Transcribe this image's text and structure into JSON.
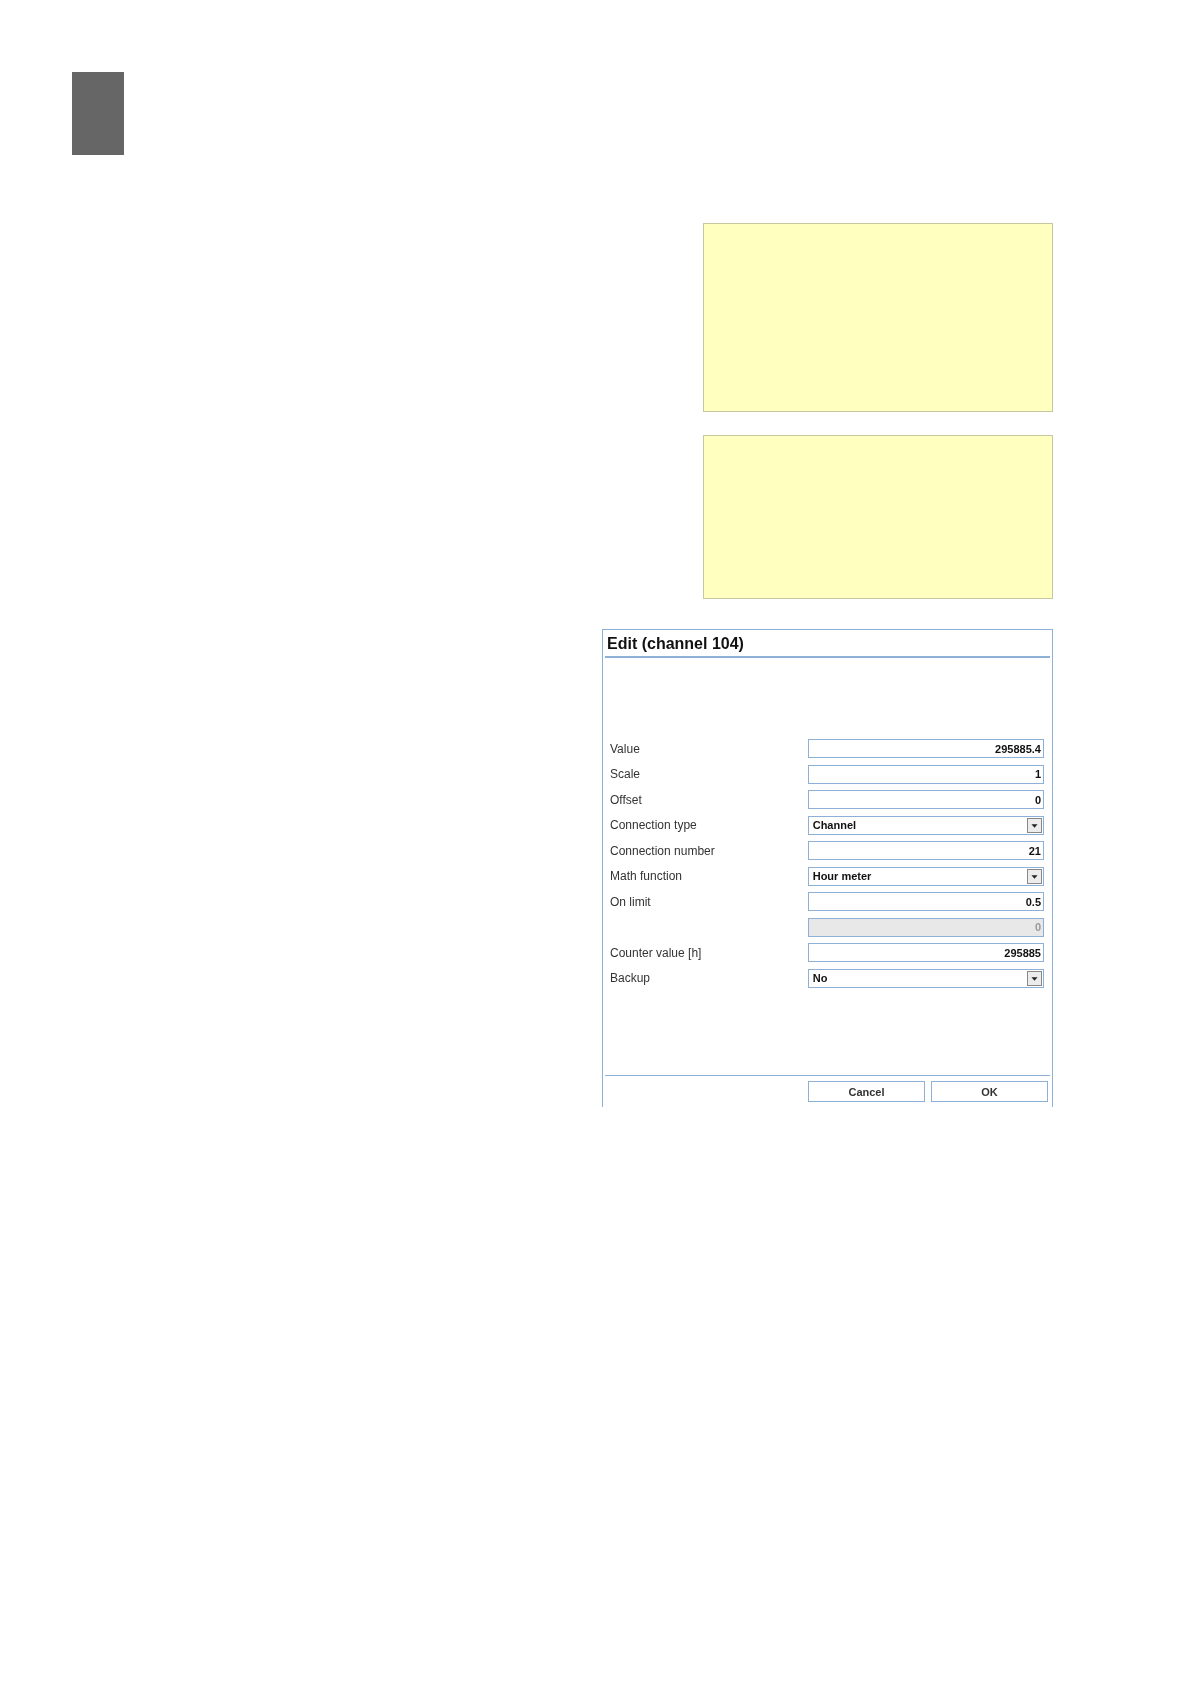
{
  "dialog": {
    "title": "Edit (channel 104)",
    "fields": [
      {
        "label": "Value",
        "kind": "text",
        "value": "295885.4",
        "disabled": false
      },
      {
        "label": "Scale",
        "kind": "text",
        "value": "1",
        "disabled": false
      },
      {
        "label": "Offset",
        "kind": "text",
        "value": "0",
        "disabled": false
      },
      {
        "label": "Connection type",
        "kind": "select",
        "value": "Channel",
        "disabled": false
      },
      {
        "label": "Connection number",
        "kind": "text",
        "value": "21",
        "disabled": false
      },
      {
        "label": "Math function",
        "kind": "select",
        "value": "Hour meter",
        "disabled": false
      },
      {
        "label": "On limit",
        "kind": "text",
        "value": "0.5",
        "disabled": false
      },
      {
        "kind": "text",
        "value": "0",
        "disabled": true
      },
      {
        "label": "Counter value [h]",
        "kind": "text",
        "value": "295885",
        "disabled": false
      },
      {
        "label": "Backup",
        "kind": "select",
        "value": "No",
        "disabled": false
      }
    ],
    "buttons": [
      "Cancel",
      "OK"
    ]
  }
}
